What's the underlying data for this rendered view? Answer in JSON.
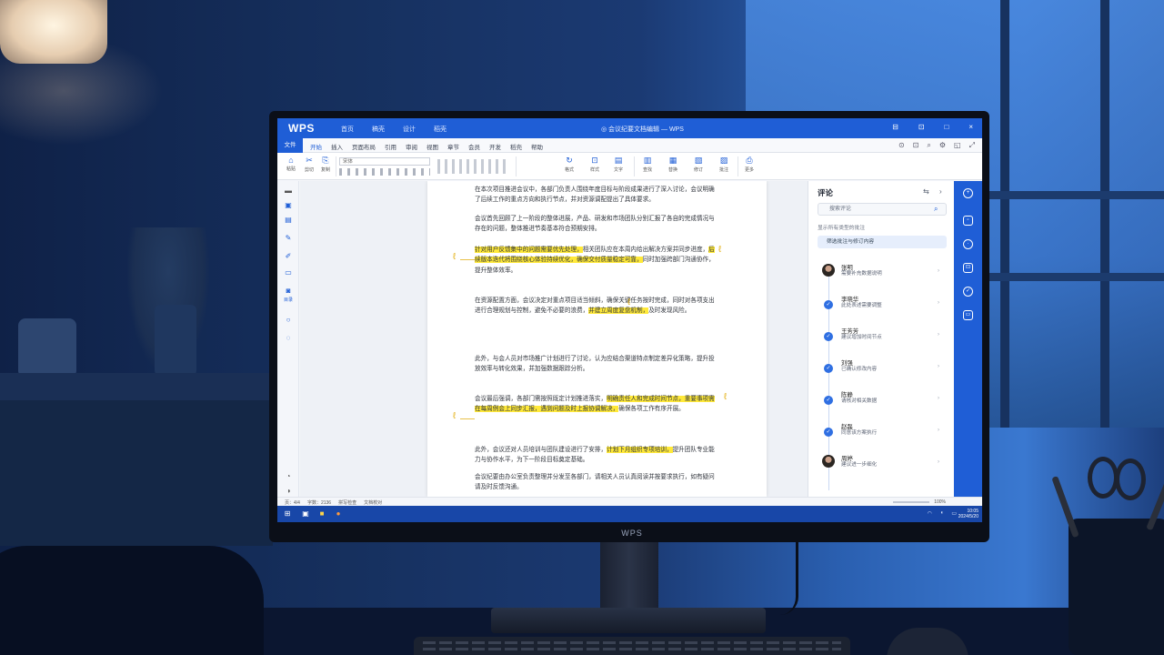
{
  "window": {
    "logo": "WPS",
    "top_menu": [
      "首页",
      "稿壳",
      "设计",
      "稻壳"
    ],
    "doc_title": "◎ 会议纪要文档编辑 — WPS",
    "controls": [
      "⊟",
      "⊡",
      "□",
      "×"
    ]
  },
  "ribbon_tabs": {
    "file": "文件",
    "items": [
      "开始",
      "插入",
      "页面布局",
      "引用",
      "审阅",
      "视图",
      "章节",
      "会员",
      "开发",
      "稻壳",
      "帮助"
    ],
    "right_icons": [
      "⊙",
      "⊡",
      "⌕",
      "⚙",
      "◱",
      "⤢"
    ]
  },
  "ribbon": {
    "font_name": "宋体",
    "buttons": [
      {
        "icon": "⌂",
        "label": "粘贴"
      },
      {
        "icon": "✂",
        "label": "剪切"
      },
      {
        "icon": "⎘",
        "label": "复制"
      },
      {
        "icon": "↻",
        "label": "格式"
      },
      {
        "icon": "⊡",
        "label": "样式"
      },
      {
        "icon": "▤",
        "label": "文字"
      },
      {
        "icon": "▥",
        "label": "查找"
      },
      {
        "icon": "▦",
        "label": "替换"
      },
      {
        "icon": "▧",
        "label": "修订"
      },
      {
        "icon": "▨",
        "label": "批注"
      },
      {
        "icon": "⎙",
        "label": "更多"
      }
    ]
  },
  "left_rail": {
    "label": "目录"
  },
  "document": {
    "paragraphs": [
      {
        "segments": [
          {
            "text": "在本次项目推进会议中，各部门负责人围绕年度目标与阶段成果进行了深入讨论，会议明确了后续工作的重点方向和执行节点，并对资源调配提出了具体要求。",
            "hl": false
          }
        ]
      },
      {
        "segments": [
          {
            "text": "会议首先回顾了上一阶段的整体进展，产品、研发和市场团队分别汇报了各自的完成情况与存在的问题，整体推进节奏基本符合预期安排。",
            "hl": false
          }
        ]
      },
      {
        "segments": [
          {
            "text": "针对用户反馈集中的问题需要优先处理，",
            "hl": true
          },
          {
            "text": "相关团队应在本周内给出解决方案并同步进度，",
            "hl": false
          },
          {
            "text": "后续版本迭代将围绕核心体验持续优化，确保交付质量稳定可靠，",
            "hl": true
          },
          {
            "text": "同时加强跨部门沟通协作，提升整体效率。",
            "hl": false
          }
        ]
      },
      {
        "segments": [
          {
            "text": "在资源配置方面，会议决定对重点项目适当倾斜，确保关键任务按时完成，同时对各项支出进行合理规划与控制，避免不必要的浪费，",
            "hl": false
          },
          {
            "text": "并建立周度复盘机制，",
            "hl": true
          },
          {
            "text": "及时发现风险。",
            "hl": false
          }
        ]
      },
      {
        "segments": [
          {
            "text": "此外，与会人员对市场推广计划进行了讨论，认为应结合渠道特点制定差异化策略，提升投放效率与转化效果，并加强数据跟踪分析。",
            "hl": false
          }
        ]
      },
      {
        "segments": [
          {
            "text": "会议最后强调，各部门需按照既定计划推进落实，",
            "hl": false
          },
          {
            "text": "明确责任人和完成时间节点，重要事项需在每周例会上同步汇报，遇到问题及时上报协调解决，",
            "hl": true
          },
          {
            "text": "确保各项工作有序开展。",
            "hl": false
          }
        ]
      },
      {
        "segments": [
          {
            "text": "此外，会议还对人员培训与团队建设进行了安排，",
            "hl": false
          },
          {
            "text": "计划下月组织专项培训，",
            "hl": true
          },
          {
            "text": "提升团队专业能力与协作水平，为下一阶段目标奠定基础。",
            "hl": false
          }
        ]
      },
      {
        "segments": [
          {
            "text": "会议纪要由办公室负责整理并分发至各部门，请相关人员认真阅读并按要求执行，如有疑问请及时反馈沟通。",
            "hl": false
          }
        ]
      }
    ]
  },
  "comments": {
    "title": "评论",
    "search_placeholder": "搜索评论",
    "filter_label": "显示所有类型的批注",
    "chip": "筛选批注与修订内容",
    "items": [
      {
        "name": "张明",
        "text": "需要补充数据说明",
        "type": "avatar"
      },
      {
        "name": "李晓华",
        "text": "此处表述需要调整",
        "type": "dot"
      },
      {
        "name": "王芳芳",
        "text": "建议增加时间节点",
        "type": "dot"
      },
      {
        "name": "刘强",
        "text": "已确认修改内容",
        "type": "dot"
      },
      {
        "name": "陈静",
        "text": "请核对相关数据",
        "type": "dot"
      },
      {
        "name": "赵磊",
        "text": "同意该方案执行",
        "type": "dot"
      },
      {
        "name": "周婷",
        "text": "建议进一步细化",
        "type": "avatar"
      }
    ]
  },
  "status_bar": {
    "page": "页：4/4",
    "words": "字数：2136",
    "spell": "拼写检查",
    "mode": "文档校对",
    "zoom": "100%"
  },
  "taskbar": {
    "time": "10:05",
    "date": "2024/5/20"
  },
  "monitor_brand": "WPS"
}
